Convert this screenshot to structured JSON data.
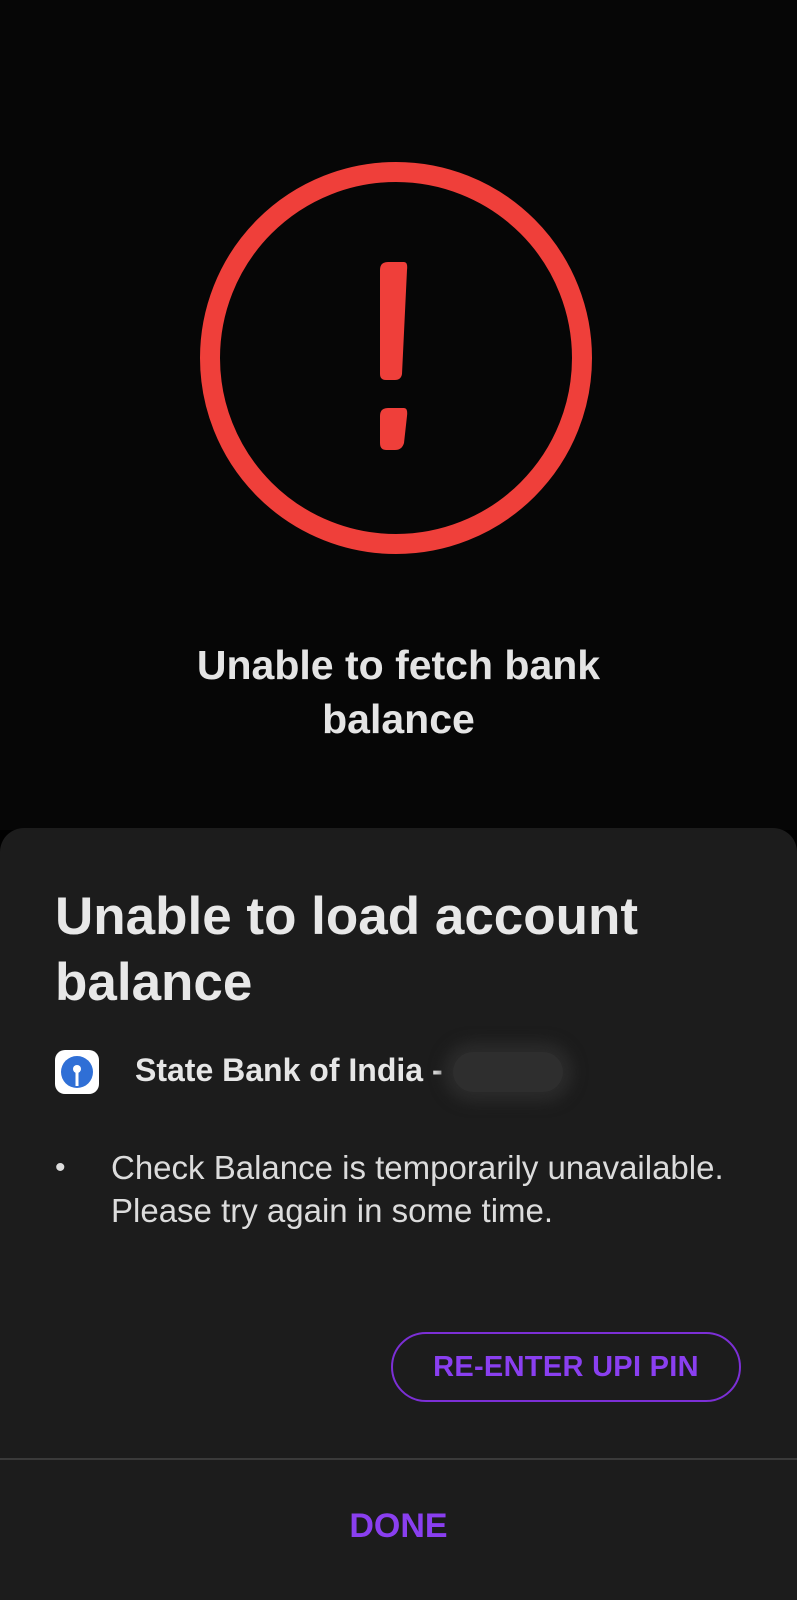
{
  "error": {
    "icon": "exclamation-circle-icon",
    "icon_color": "#ef3f3a",
    "title": "Unable to fetch bank balance"
  },
  "sheet": {
    "title": "Unable to load account balance",
    "bank": {
      "logo_icon": "sbi-logo-icon",
      "name": "State Bank of India -"
    },
    "bullets": [
      "Check Balance is temporarily unavailable. Please try again in some time."
    ],
    "reenter_label": "RE-ENTER UPI PIN",
    "done_label": "DONE",
    "accent_color": "#8a3ff0"
  }
}
